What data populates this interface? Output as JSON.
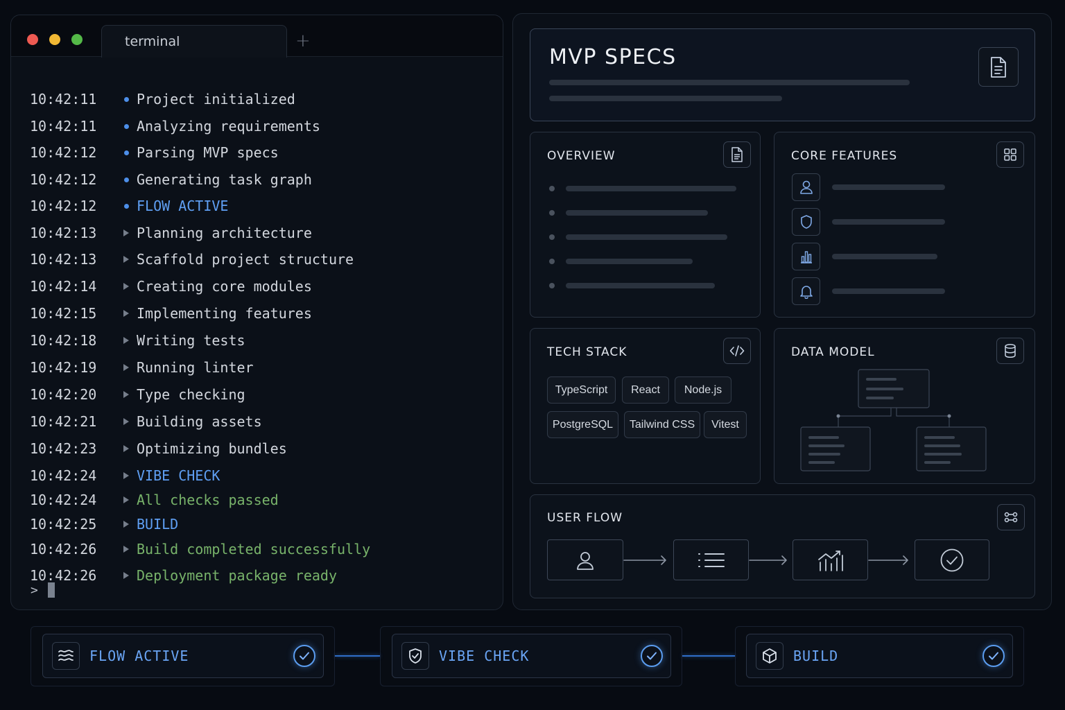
{
  "terminal": {
    "tab_label": "terminal",
    "new_tab_icon": "plus-icon",
    "lines": [
      {
        "time": "10:42:11",
        "marker": "bullet",
        "message": "Project initialized",
        "tone": "default"
      },
      {
        "time": "10:42:11",
        "marker": "bullet",
        "message": "Analyzing requirements",
        "tone": "default"
      },
      {
        "time": "10:42:12",
        "marker": "bullet",
        "message": "Parsing MVP specs",
        "tone": "default"
      },
      {
        "time": "10:42:12",
        "marker": "bullet",
        "message": "Generating task graph",
        "tone": "default"
      },
      {
        "time": "10:42:12",
        "marker": "bullet",
        "message": "FLOW ACTIVE",
        "tone": "blue"
      },
      {
        "time": "10:42:13",
        "marker": "triangle",
        "message": "Planning architecture",
        "tone": "default"
      },
      {
        "time": "10:42:13",
        "marker": "triangle",
        "message": "Scaffold project structure",
        "tone": "default"
      },
      {
        "time": "10:42:14",
        "marker": "triangle",
        "message": "Creating core modules",
        "tone": "default"
      },
      {
        "time": "10:42:15",
        "marker": "triangle",
        "message": "Implementing features",
        "tone": "default"
      },
      {
        "time": "10:42:18",
        "marker": "triangle",
        "message": "Writing tests",
        "tone": "default"
      },
      {
        "time": "10:42:19",
        "marker": "triangle",
        "message": "Running linter",
        "tone": "default"
      },
      {
        "time": "10:42:20",
        "marker": "triangle",
        "message": "Type checking",
        "tone": "default"
      },
      {
        "time": "10:42:21",
        "marker": "triangle",
        "message": "Building assets",
        "tone": "default"
      },
      {
        "time": "10:42:23",
        "marker": "triangle",
        "message": "Optimizing bundles",
        "tone": "default"
      },
      {
        "time": "10:42:24",
        "marker": "triangle",
        "message": "VIBE CHECK",
        "tone": "blue"
      },
      {
        "time": "10:42:24",
        "marker": "triangle",
        "message": "All checks passed",
        "tone": "green"
      },
      {
        "time": "10:42:25",
        "marker": "triangle",
        "message": "BUILD",
        "tone": "blue"
      },
      {
        "time": "10:42:26",
        "marker": "triangle",
        "message": "Build completed successfully",
        "tone": "green"
      },
      {
        "time": "10:42:26",
        "marker": "triangle",
        "message": "Deployment package ready",
        "tone": "green"
      }
    ],
    "prompt": ">"
  },
  "specs": {
    "title": "MVP SPECS",
    "title_icon": "document-icon",
    "overview": {
      "title": "OVERVIEW",
      "icon": "document-icon"
    },
    "core_features": {
      "title": "CORE FEATURES",
      "icon": "grid-icon",
      "feature_icons": [
        "user-icon",
        "shield-icon",
        "bar-chart-icon",
        "bell-icon"
      ]
    },
    "tech_stack": {
      "title": "TECH STACK",
      "icon": "code-icon",
      "chips": [
        "TypeScript",
        "React",
        "Node.js",
        "PostgreSQL",
        "Tailwind CSS",
        "Vitest"
      ]
    },
    "data_model": {
      "title": "DATA MODEL",
      "icon": "database-icon"
    },
    "user_flow": {
      "title": "USER FLOW",
      "icon": "flow-icon",
      "steps": [
        "user-icon",
        "list-icon",
        "chart-icon",
        "check-circle-icon"
      ]
    }
  },
  "pipeline": [
    {
      "label": "FLOW ACTIVE",
      "icon": "waves-icon",
      "status": "complete"
    },
    {
      "label": "VIBE CHECK",
      "icon": "shield-check-icon",
      "status": "complete"
    },
    {
      "label": "BUILD",
      "icon": "package-icon",
      "status": "complete"
    }
  ],
  "colors": {
    "background": "#070b12",
    "accent_blue": "#5f9ff3",
    "success_green": "#78b36a",
    "window_red": "#ee5a52",
    "window_yellow": "#f1b834",
    "window_green": "#54b948"
  }
}
